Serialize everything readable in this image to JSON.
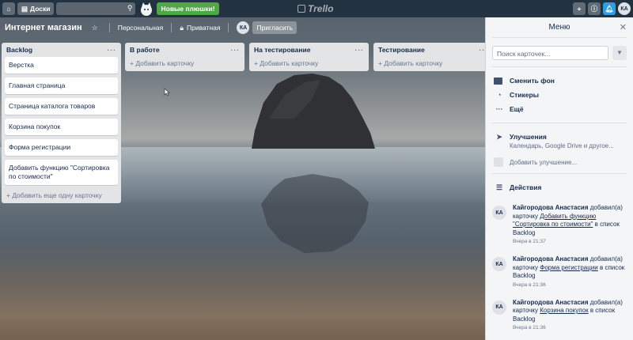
{
  "header": {
    "boards_label": "Доски",
    "promo_label": "Новые плюшки!",
    "logo_text": "Trello",
    "avatar_initials": "КА"
  },
  "board": {
    "title": "Интернет магазин",
    "team": "Персональная",
    "visibility": "Приватная",
    "member_initials": "КА",
    "invite_label": "Пригласить"
  },
  "lists": [
    {
      "title": "Backlog",
      "cards": [
        "Верстка",
        "Главная страница",
        "Страница каталога товаров",
        "Корзина покупок",
        "Форма регистрации",
        "Добавить функцию \"Сортировка по стоимости\""
      ],
      "add_label": "+ Добавить еще одну карточку"
    },
    {
      "title": "В работе",
      "add_label": "+ Добавить карточку"
    },
    {
      "title": "На тестирование",
      "add_label": "+ Добавить карточку"
    },
    {
      "title": "Тестирование",
      "add_label": "+ Добавить карточку"
    }
  ],
  "menu": {
    "title": "Меню",
    "search_placeholder": "Поиск карточек...",
    "change_bg": "Сменить фон",
    "stickers": "Стикеры",
    "more": "Ещё",
    "powerups_title": "Улучшения",
    "powerups_sub": "Календарь, Google Drive и другое...",
    "add_powerup": "Добавить улучшение...",
    "activity_title": "Действия",
    "activities": [
      {
        "initials": "КА",
        "user": "Кайгородова Анастасия",
        "pre": " добавил(а) карточку ",
        "card": "Добавить функцию \"Сортировка по стоимости\"",
        "post": " в список Backlog",
        "time": "Вчера в 21:37"
      },
      {
        "initials": "КА",
        "user": "Кайгородова Анастасия",
        "pre": " добавил(а) карточку ",
        "card": "Форма регистрации",
        "post": " в список Backlog",
        "time": "Вчера в 21:36"
      },
      {
        "initials": "КА",
        "user": "Кайгородова Анастасия",
        "pre": " добавил(а) карточку ",
        "card": "Корзина покупок",
        "post": " в список Backlog",
        "time": "Вчера в 21:36"
      }
    ]
  },
  "colors": {
    "promo": "#4fa846",
    "notification": "#2d9ee0"
  }
}
